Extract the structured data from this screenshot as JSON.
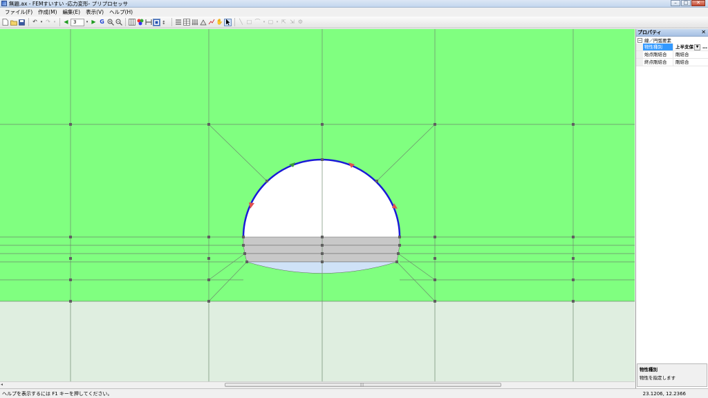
{
  "window": {
    "title": "無題.ax - FEMすいすい -応力変形- プリプロセッサ",
    "minimize": "–",
    "maximize": "□",
    "close": "✕"
  },
  "menu": [
    {
      "label": "ファイル(F)",
      "name": "menu-file"
    },
    {
      "label": "作成(M)",
      "name": "menu-create"
    },
    {
      "label": "編集(E)",
      "name": "menu-edit"
    },
    {
      "label": "表示(V)",
      "name": "menu-view"
    },
    {
      "label": "ヘルプ(H)",
      "name": "menu-help"
    }
  ],
  "toolbar": {
    "step_value": "3"
  },
  "canvas": {
    "colors": {
      "ground": "#80ff80",
      "base": "#dfeee0",
      "tunnel": "#ffffff",
      "bench": "#c8c8c8",
      "invert": "#cfe2f7",
      "lining": "#1a1ad6",
      "mesh": "#6d8a6d",
      "node": "#606060"
    }
  },
  "properties": {
    "title": "プロパティ",
    "group": "線／円弧要素",
    "rows": [
      {
        "key": "物性種別",
        "value": "上半支保",
        "selected": true
      },
      {
        "key": "始点剛結合",
        "value": "剛結合",
        "selected": false
      },
      {
        "key": "終点剛結合",
        "value": "剛結合",
        "selected": false
      }
    ],
    "description_title": "物性種別",
    "description_text": "物性を指定します"
  },
  "status": {
    "help_text": "ヘルプを表示するには F1 キーを押してください。",
    "coords": "23.1206, 12.2366"
  }
}
